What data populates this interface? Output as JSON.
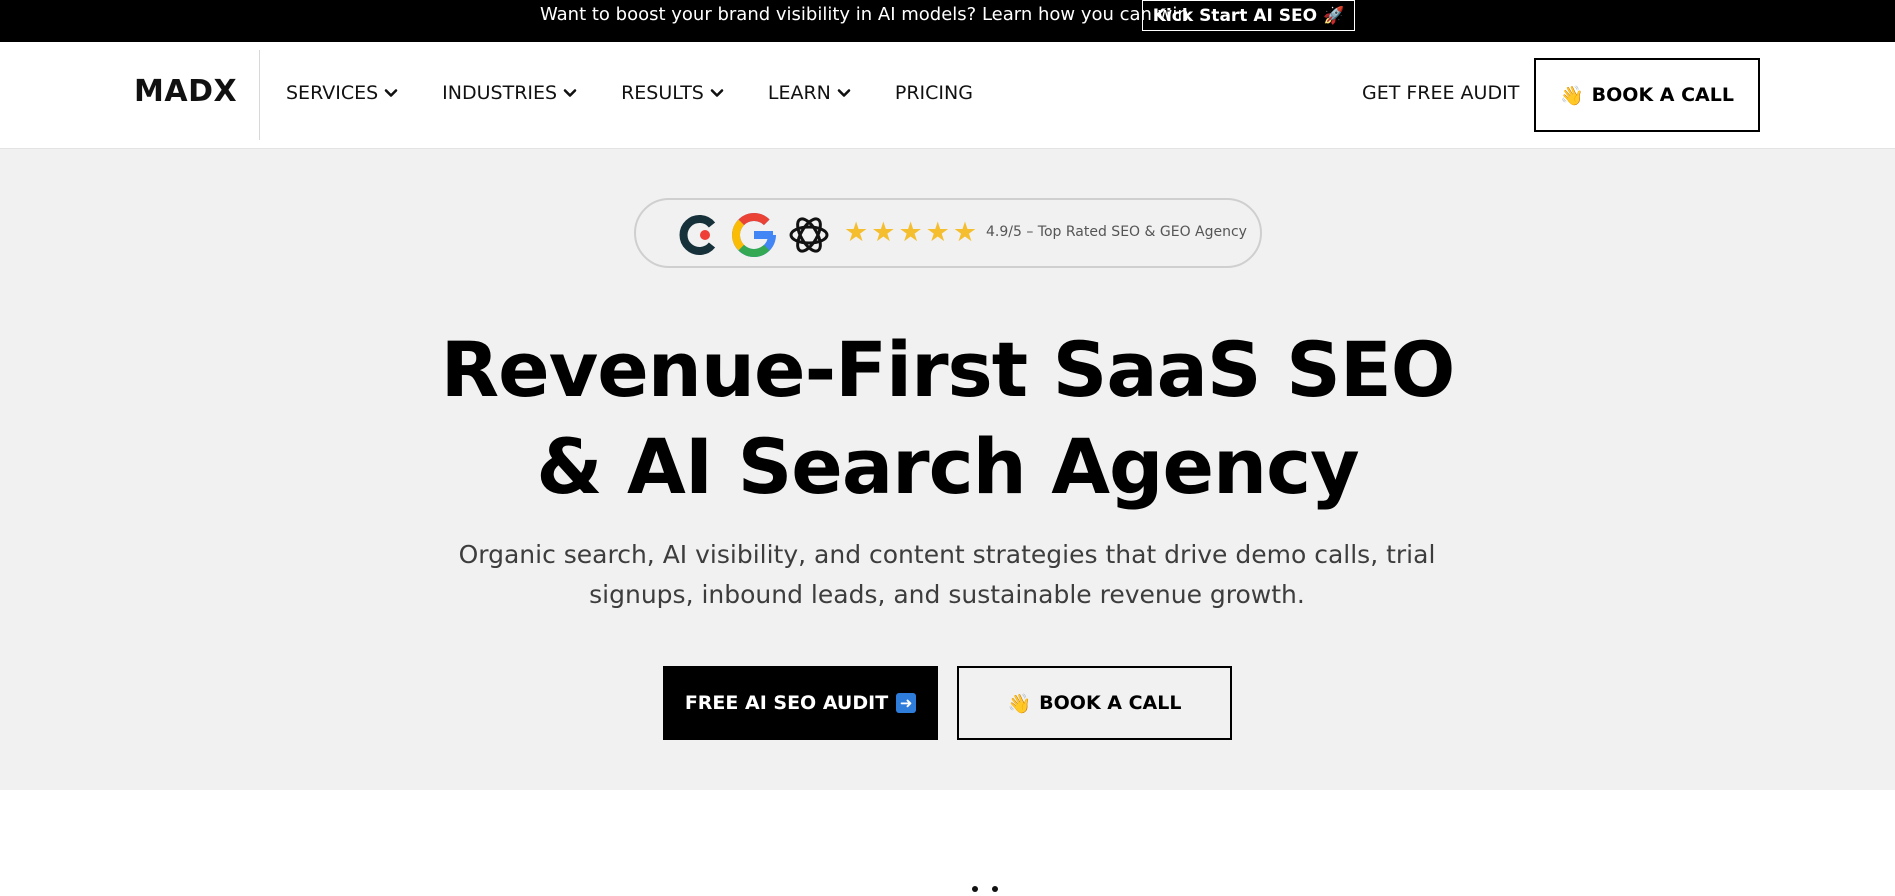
{
  "announcement": {
    "text": "Want to boost your brand visibility in AI models? Learn how you can win",
    "cta_label": "Kick Start AI SEO",
    "cta_icon": "rocket-icon"
  },
  "header": {
    "logo": "MADX",
    "nav": [
      {
        "label": "SERVICES",
        "has_dropdown": true
      },
      {
        "label": "INDUSTRIES",
        "has_dropdown": true
      },
      {
        "label": "RESULTS",
        "has_dropdown": true
      },
      {
        "label": "LEARN",
        "has_dropdown": true
      },
      {
        "label": "PRICING",
        "has_dropdown": false
      }
    ],
    "get_audit_label": "GET FREE AUDIT",
    "book_call_label": "BOOK A CALL",
    "book_call_icon": "waving-hand-icon"
  },
  "hero": {
    "rating": {
      "icons": [
        "clutch-logo-icon",
        "google-logo-icon",
        "openai-logo-icon"
      ],
      "stars": 5,
      "text": "4.9/5 – Top Rated SEO & GEO Agency"
    },
    "headline_line1": "Revenue-First SaaS SEO",
    "headline_line2": "& AI Search Agency",
    "subtitle_line1": "Organic search, AI visibility, and content strategies that drive demo calls, trial",
    "subtitle_line2": "signups, inbound leads, and sustainable revenue growth.",
    "primary_cta": "FREE AI SEO AUDIT",
    "primary_cta_icon": "arrow-right-icon",
    "secondary_cta": "BOOK A CALL",
    "secondary_cta_icon": "waving-hand-icon"
  },
  "colors": {
    "topbar_bg": "#000000",
    "hero_bg": "#f1f1f1",
    "star": "#f4be2f",
    "arrow_box": "#2f7ddb"
  }
}
